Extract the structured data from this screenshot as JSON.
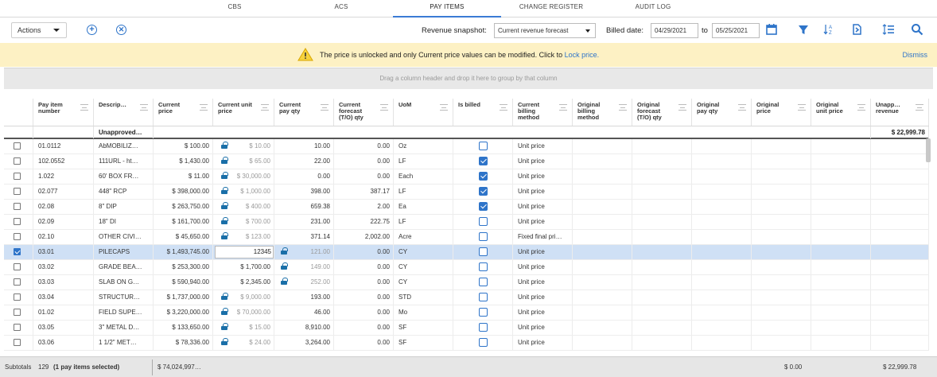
{
  "tabs": [
    {
      "label": "CBS"
    },
    {
      "label": "ACS"
    },
    {
      "label": "PAY ITEMS",
      "active": true
    },
    {
      "label": "CHANGE REGISTER"
    },
    {
      "label": "AUDIT LOG"
    }
  ],
  "toolbar": {
    "actions_label": "Actions",
    "revenue_snapshot_label": "Revenue snapshot:",
    "revenue_snapshot_value": "Current revenue forecast",
    "billed_date_label": "Billed date:",
    "billed_date_from": "04/29/2021",
    "to_label": "to",
    "billed_date_to": "05/25/2021"
  },
  "banner": {
    "message": "The price is unlocked and only Current price values can be modified. Click to ",
    "link": "Lock price.",
    "dismiss": "Dismiss"
  },
  "group_hint": "Drag a column header and drop it here to group by that column",
  "columns": {
    "pay_item_number": "Pay item number",
    "description": "Descrip…",
    "current_price": "Current price",
    "current_unit_price": "Current unit price",
    "current_pay_qty": "Current pay qty",
    "current_forecast_qty": "Current forecast (T/O) qty",
    "uom": "UoM",
    "is_billed": "Is billed",
    "current_billing_method": "Current billing method",
    "original_billing_method": "Original billing method",
    "original_forecast_qty": "Original forecast (T/O) qty",
    "original_pay_qty": "Original pay qty",
    "original_price": "Original price",
    "original_unit_price": "Original unit price",
    "unapproved_revenue": "Unapp… revenue"
  },
  "filter_row": {
    "description": "Unapproved…",
    "unapproved_revenue": "$ 22,999.78"
  },
  "rows": [
    {
      "checked": false,
      "number": "01.0112",
      "desc": "AbMOBILIZ…",
      "price": "$ 100.00",
      "lock": true,
      "unit_price": "$ 10.00",
      "unit_muted": true,
      "pay_qty": "10.00",
      "forecast": "0.00",
      "uom": "Oz",
      "billed": false,
      "method": "Unit price"
    },
    {
      "checked": false,
      "number": "102.0552",
      "desc": "111URL - ht…",
      "price": "$ 1,430.00",
      "lock": true,
      "unit_price": "$ 65.00",
      "unit_muted": true,
      "pay_qty": "22.00",
      "forecast": "0.00",
      "uom": "LF",
      "billed": true,
      "method": "Unit price"
    },
    {
      "checked": false,
      "number": "1.022",
      "desc": "60' BOX FR…",
      "price": "$ 11.00",
      "lock": true,
      "unit_price": "$ 30,000.00",
      "unit_muted": true,
      "pay_qty": "0.00",
      "forecast": "0.00",
      "uom": "Each",
      "billed": true,
      "method": "Unit price"
    },
    {
      "checked": false,
      "number": "02.077",
      "desc": "448\" RCP",
      "price": "$ 398,000.00",
      "lock": true,
      "unit_price": "$ 1,000.00",
      "unit_muted": true,
      "pay_qty": "398.00",
      "forecast": "387.17",
      "uom": "LF",
      "billed": true,
      "method": "Unit price"
    },
    {
      "checked": false,
      "number": "02.08",
      "desc": "8\" DIP",
      "price": "$ 263,750.00",
      "lock": true,
      "unit_price": "$ 400.00",
      "unit_muted": true,
      "pay_qty": "659.38",
      "forecast": "2.00",
      "uom": "Ea",
      "billed": true,
      "method": "Unit price"
    },
    {
      "checked": false,
      "number": "02.09",
      "desc": "18\" DI",
      "price": "$ 161,700.00",
      "lock": true,
      "unit_price": "$ 700.00",
      "unit_muted": true,
      "pay_qty": "231.00",
      "forecast": "222.75",
      "uom": "LF",
      "billed": false,
      "method": "Unit price"
    },
    {
      "checked": false,
      "number": "02.10",
      "desc": "OTHER CIVI…",
      "price": "$ 45,650.00",
      "lock": true,
      "unit_price": "$ 123.00",
      "unit_muted": true,
      "pay_qty": "371.14",
      "forecast": "2,002.00",
      "uom": "Acre",
      "billed": false,
      "method": "Fixed final pri…"
    },
    {
      "checked": true,
      "selected": true,
      "number": "03.01",
      "desc": "PILECAPS",
      "price": "$ 1,493,745.00",
      "editing": true,
      "unit_price": "12345",
      "pay_lock": true,
      "pay_qty": "121.00",
      "pay_muted": true,
      "forecast": "0.00",
      "uom": "CY",
      "billed": false,
      "method": "Unit price"
    },
    {
      "checked": false,
      "number": "03.02",
      "desc": "GRADE BEA…",
      "price": "$ 253,300.00",
      "unit_price": "$ 1,700.00",
      "pay_lock": true,
      "pay_qty": "149.00",
      "pay_muted": true,
      "forecast": "0.00",
      "uom": "CY",
      "billed": false,
      "method": "Unit price"
    },
    {
      "checked": false,
      "number": "03.03",
      "desc": "SLAB ON G…",
      "price": "$ 590,940.00",
      "unit_price": "$ 2,345.00",
      "pay_lock": true,
      "pay_qty": "252.00",
      "pay_muted": true,
      "forecast": "0.00",
      "uom": "CY",
      "billed": false,
      "method": "Unit price"
    },
    {
      "checked": false,
      "number": "03.04",
      "desc": "STRUCTUR…",
      "price": "$ 1,737,000.00",
      "lock": true,
      "unit_price": "$ 9,000.00",
      "unit_muted": true,
      "pay_qty": "193.00",
      "forecast": "0.00",
      "uom": "STD",
      "billed": false,
      "method": "Unit price"
    },
    {
      "checked": false,
      "number": "01.02",
      "desc": "FIELD SUPE…",
      "price": "$ 3,220,000.00",
      "lock": true,
      "unit_price": "$ 70,000.00",
      "unit_muted": true,
      "pay_qty": "46.00",
      "forecast": "0.00",
      "uom": "Mo",
      "billed": false,
      "method": "Unit price"
    },
    {
      "checked": false,
      "number": "03.05",
      "desc": "3\" METAL D…",
      "price": "$ 133,650.00",
      "lock": true,
      "unit_price": "$ 15.00",
      "unit_muted": true,
      "pay_qty": "8,910.00",
      "forecast": "0.00",
      "uom": "SF",
      "billed": false,
      "method": "Unit price"
    },
    {
      "checked": false,
      "number": "03.06",
      "desc": "1 1/2\" MET…",
      "price": "$ 78,336.00",
      "lock": true,
      "unit_price": "$ 24.00",
      "unit_muted": true,
      "pay_qty": "3,264.00",
      "forecast": "0.00",
      "uom": "SF",
      "billed": false,
      "method": "Unit price"
    }
  ],
  "footer": {
    "subtotals_label": "Subtotals",
    "count": "129",
    "selected_note": "(1 pay items selected)",
    "price_total": "$ 74,024,997…",
    "original_price_total": "$ 0.00",
    "revenue_total": "$ 22,999.78"
  },
  "colors": {
    "accent": "#2e74c9",
    "banner_bg": "#fdf1c4",
    "selected_row": "#cfe0f5",
    "lock": "#1a6fa8"
  }
}
